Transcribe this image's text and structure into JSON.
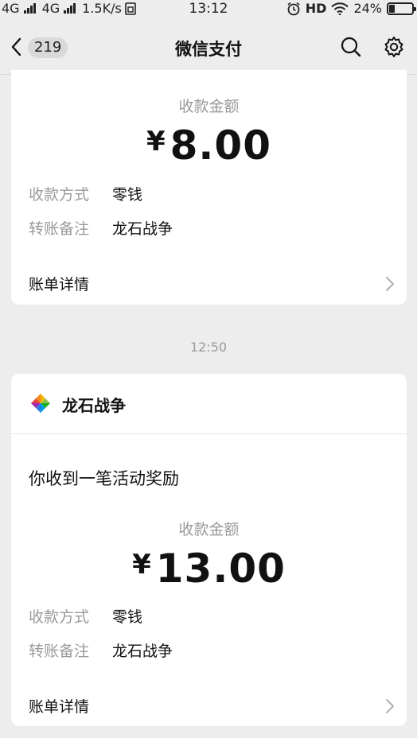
{
  "status_bar": {
    "network1": "4G",
    "network2": "4G",
    "speed": "1.5K/s",
    "time": "13:12",
    "hd": "HD",
    "battery": "24%",
    "battery_level": 0.24
  },
  "nav": {
    "unread_count": "219",
    "title": "微信支付"
  },
  "messages": [
    {
      "amount_label": "收款金额",
      "currency": "¥",
      "amount": "8.00",
      "method_label": "收款方式",
      "method": "零钱",
      "note_label": "转账备注",
      "note": "龙石战争",
      "detail_label": "账单详情"
    },
    {
      "time": "12:50",
      "merchant": "龙石战争",
      "notice": "你收到一笔活动奖励",
      "amount_label": "收款金额",
      "currency": "¥",
      "amount": "13.00",
      "method_label": "收款方式",
      "method": "零钱",
      "note_label": "转账备注",
      "note": "龙石战争",
      "detail_label": "账单详情"
    }
  ],
  "icons": {
    "back": "chevron-left-icon",
    "search": "search-icon",
    "settings": "gear-icon",
    "detail": "chevron-right-icon",
    "merchant_logo": "app-logo"
  }
}
